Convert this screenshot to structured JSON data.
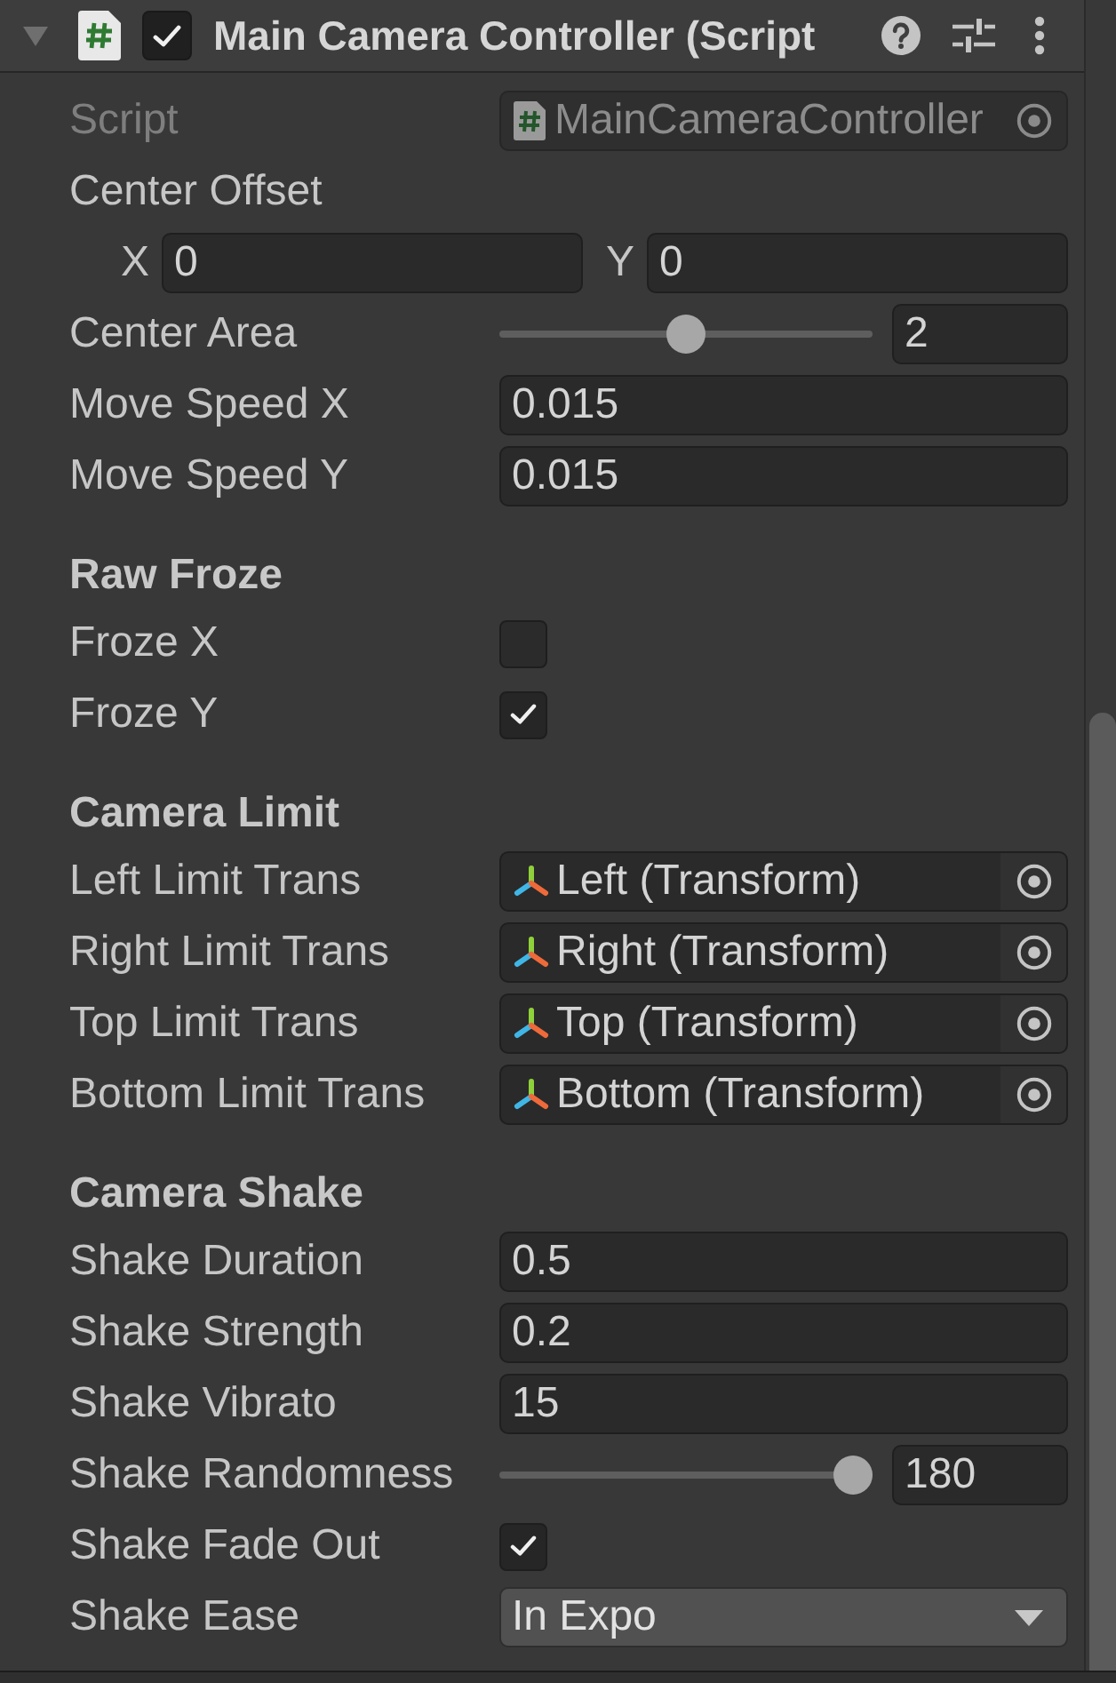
{
  "inspector": {
    "component": {
      "title": "Main Camera Controller (Script",
      "expanded": true,
      "enabled": true
    },
    "script": {
      "label": "Script",
      "value": "MainCameraController",
      "disabled": true
    },
    "properties": [
      {
        "kind": "vector2",
        "label": "Center Offset",
        "components": [
          {
            "label": "X",
            "value": "0"
          },
          {
            "label": "Y",
            "value": "0"
          }
        ]
      },
      {
        "kind": "slider",
        "label": "Center Area",
        "level": 0.5,
        "value": "2"
      },
      {
        "kind": "number",
        "label": "Move Speed X",
        "value": "0.015"
      },
      {
        "kind": "number",
        "label": "Move Speed Y",
        "value": "0.015"
      },
      {
        "kind": "heading",
        "label": "Raw Froze"
      },
      {
        "kind": "toggle",
        "label": "Froze X",
        "checked": false
      },
      {
        "kind": "toggle",
        "label": "Froze Y",
        "checked": true
      },
      {
        "kind": "heading",
        "label": "Camera Limit"
      },
      {
        "kind": "object",
        "label": "Left Limit Trans",
        "value": "Left (Transform)"
      },
      {
        "kind": "object",
        "label": "Right Limit Trans",
        "value": "Right (Transform)"
      },
      {
        "kind": "object",
        "label": "Top Limit Trans",
        "value": "Top (Transform)"
      },
      {
        "kind": "object",
        "label": "Bottom Limit Trans",
        "value": "Bottom (Transform)"
      },
      {
        "kind": "heading",
        "label": "Camera Shake"
      },
      {
        "kind": "number",
        "label": "Shake Duration",
        "value": "0.5"
      },
      {
        "kind": "number",
        "label": "Shake Strength",
        "value": "0.2"
      },
      {
        "kind": "number",
        "label": "Shake Vibrato",
        "value": "15"
      },
      {
        "kind": "slider",
        "label": "Shake Randomness",
        "level": 1,
        "value": "180"
      },
      {
        "kind": "toggle",
        "label": "Shake Fade Out",
        "checked": true
      },
      {
        "kind": "dropdown",
        "label": "Shake Ease",
        "value": "In Expo"
      }
    ]
  }
}
